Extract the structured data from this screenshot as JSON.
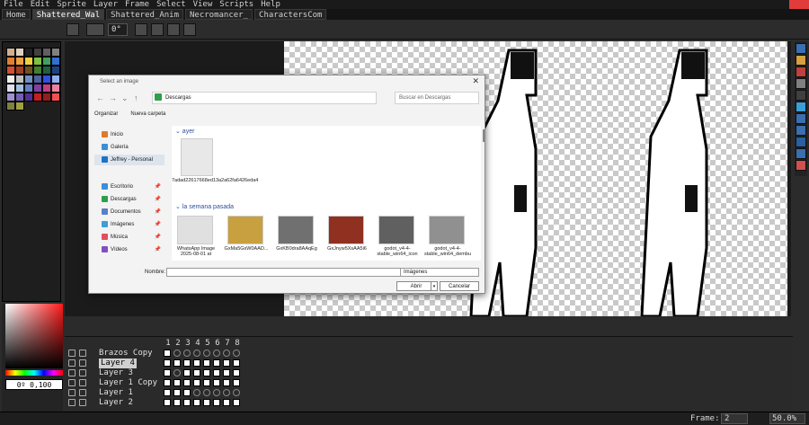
{
  "menu": [
    "File",
    "Edit",
    "Sprite",
    "Layer",
    "Frame",
    "Select",
    "View",
    "Scripts",
    "Help"
  ],
  "tabs": [
    {
      "label": "Home",
      "active": false
    },
    {
      "label": "Shattered_Wal",
      "active": true
    },
    {
      "label": "Shattered_Anim",
      "active": false
    },
    {
      "label": "Necromancer_",
      "active": false
    },
    {
      "label": "CharactersCom",
      "active": false
    }
  ],
  "toolbar": {
    "angle_value": "0°"
  },
  "palette_colors": [
    "#d0b090",
    "#e0d0c0",
    "#202020",
    "#404040",
    "#606060",
    "#808080",
    "#e08030",
    "#f0a040",
    "#f0d040",
    "#80c040",
    "#40a060",
    "#3070d0",
    "#d05030",
    "#a04020",
    "#705020",
    "#408030",
    "#206040",
    "#204080",
    "#f0f0f0",
    "#c0c0c0",
    "#7090c0",
    "#5060a0",
    "#3050e0",
    "#90b0f0",
    "#e0e0f0",
    "#a0c0e0",
    "#6080c0",
    "#8040a0",
    "#c04080",
    "#f080a0",
    "#a090d0",
    "#7060b0",
    "#503090",
    "#c02020",
    "#902020",
    "#f05050",
    "#808040",
    "#a0a040"
  ],
  "color_picker": {
    "hsv_value": "0º 0,100",
    "base_color": "#ff1a1a"
  },
  "dialog": {
    "title": "Select an image",
    "address": "Descargas",
    "search_placeholder": "Buscar en Descargas",
    "organize": "Organizar",
    "new_folder": "Nueva carpeta",
    "nav_items": [
      {
        "label": "Inicio",
        "icon": "home-icon",
        "color": "#e07a2a"
      },
      {
        "label": "Galería",
        "icon": "gallery-icon",
        "color": "#3a8fd8"
      },
      {
        "label": "Jeffrey - Personal",
        "icon": "cloud-icon",
        "color": "#1a73c8",
        "selected": true
      },
      {
        "label": "Escritorio",
        "icon": "desktop-icon",
        "color": "#3a8fd8",
        "pinned": true
      },
      {
        "label": "Descargas",
        "icon": "download-icon",
        "color": "#2e9e4b",
        "pinned": true
      },
      {
        "label": "Documentos",
        "icon": "documents-icon",
        "color": "#5a7fc8",
        "pinned": true
      },
      {
        "label": "Imágenes",
        "icon": "pictures-icon",
        "color": "#3a9fd8",
        "pinned": true
      },
      {
        "label": "Música",
        "icon": "music-icon",
        "color": "#e05060",
        "pinned": true
      },
      {
        "label": "Vídeos",
        "icon": "videos-icon",
        "color": "#8050c0",
        "pinned": true
      }
    ],
    "groups": [
      {
        "label": "ayer",
        "files": [
          {
            "name": "7adad22617668ed13a2a62fa6426eda4",
            "thumb": "#e8e8e8"
          }
        ]
      },
      {
        "label": "la semana pasada",
        "files": [
          {
            "name": "WhatsApp Image 2025-08-01 at",
            "thumb": "#e0e0e0"
          },
          {
            "name": "GxMa5GsW0AAD...",
            "thumb": "#c8a040"
          },
          {
            "name": "GxKB0dra8AAqEg",
            "thumb": "#707070"
          },
          {
            "name": "GxJnyw5XsAA5i6",
            "thumb": "#903020"
          },
          {
            "name": "godot_v4-4-stable_win64_icon",
            "thumb": "#606060"
          },
          {
            "name": "godot_v4-4-stable_win64_dembu",
            "thumb": "#909090"
          }
        ]
      }
    ],
    "filename_label": "Nombre:",
    "filename_value": "",
    "filetype": "Imágenes",
    "open_label": "Abrir",
    "cancel_label": "Cancelar"
  },
  "layers": [
    {
      "name": "Brazos Copy",
      "active": false,
      "cells": [
        1,
        0,
        0,
        0,
        0,
        0,
        0,
        0
      ]
    },
    {
      "name": "Layer 4",
      "active": true,
      "cells": [
        1,
        1,
        1,
        1,
        1,
        1,
        1,
        1
      ]
    },
    {
      "name": "Layer 3",
      "active": false,
      "cells": [
        1,
        0,
        1,
        1,
        1,
        1,
        1,
        1
      ]
    },
    {
      "name": "Layer 1 Copy",
      "active": false,
      "cells": [
        1,
        1,
        1,
        1,
        1,
        1,
        1,
        1
      ]
    },
    {
      "name": "Layer 1",
      "active": false,
      "cells": [
        1,
        1,
        1,
        0,
        0,
        0,
        0,
        0
      ]
    },
    {
      "name": "Layer 2",
      "active": false,
      "cells": [
        1,
        1,
        1,
        1,
        1,
        1,
        1,
        1
      ]
    }
  ],
  "frame_numbers": [
    "1",
    "2",
    "3",
    "4",
    "5",
    "6",
    "7",
    "8"
  ],
  "status": {
    "frame_label": "Frame:",
    "frame_value": "2",
    "zoom_value": "50.0%"
  }
}
